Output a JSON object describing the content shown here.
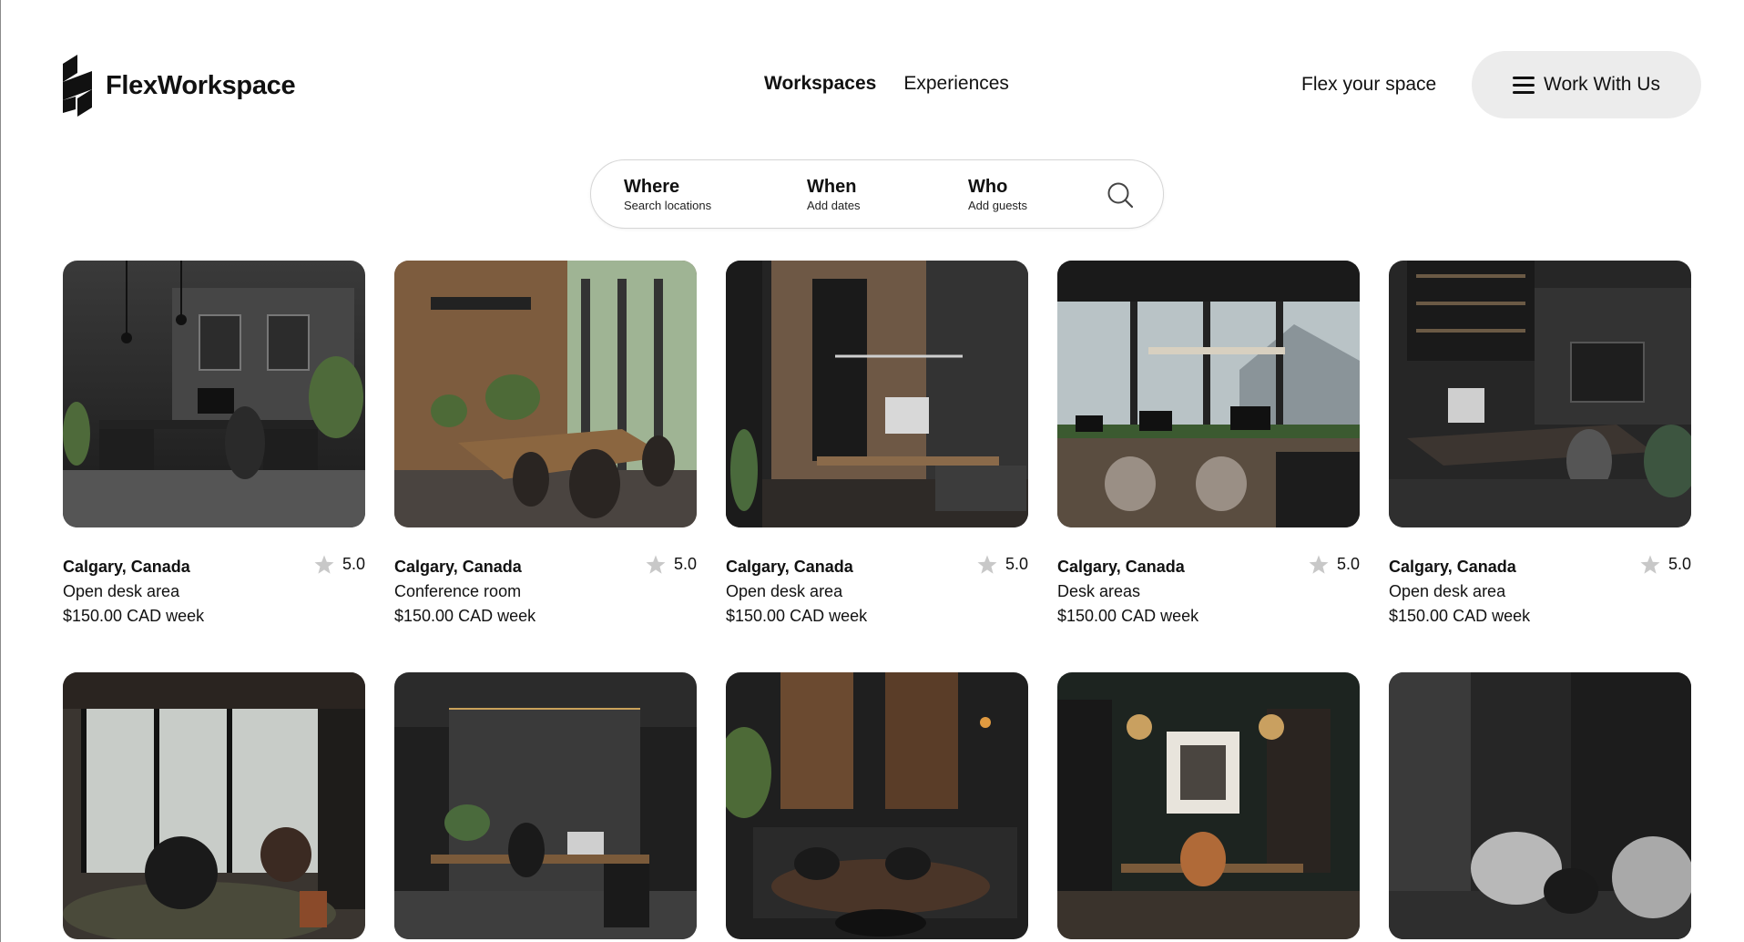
{
  "brand": {
    "name": "FlexWorkspace"
  },
  "nav": {
    "links": [
      {
        "label": "Workspaces",
        "active": true
      },
      {
        "label": "Experiences",
        "active": false
      }
    ],
    "flex_link": "Flex your space",
    "cta_label": "Work With Us"
  },
  "search": {
    "where": {
      "title": "Where",
      "subtitle": "Search locations"
    },
    "when": {
      "title": "When",
      "subtitle": "Add dates"
    },
    "who": {
      "title": "Who",
      "subtitle": "Add guests"
    }
  },
  "listings": [
    {
      "location": "Calgary, Canada",
      "type": "Open desk area",
      "price": "$150.00 CAD week",
      "rating": "5.0"
    },
    {
      "location": "Calgary, Canada",
      "type": "Conference room",
      "price": "$150.00 CAD week",
      "rating": "5.0"
    },
    {
      "location": "Calgary, Canada",
      "type": "Open desk area",
      "price": "$150.00 CAD week",
      "rating": "5.0"
    },
    {
      "location": "Calgary, Canada",
      "type": "Desk areas",
      "price": "$150.00 CAD week",
      "rating": "5.0"
    },
    {
      "location": "Calgary, Canada",
      "type": "Open desk area",
      "price": "$150.00 CAD week",
      "rating": "5.0"
    },
    {},
    {},
    {},
    {},
    {}
  ],
  "colors": {
    "text": "#111111",
    "button_bg": "#ececec",
    "star": "#c8c8c8",
    "border": "#d6d6d6"
  }
}
